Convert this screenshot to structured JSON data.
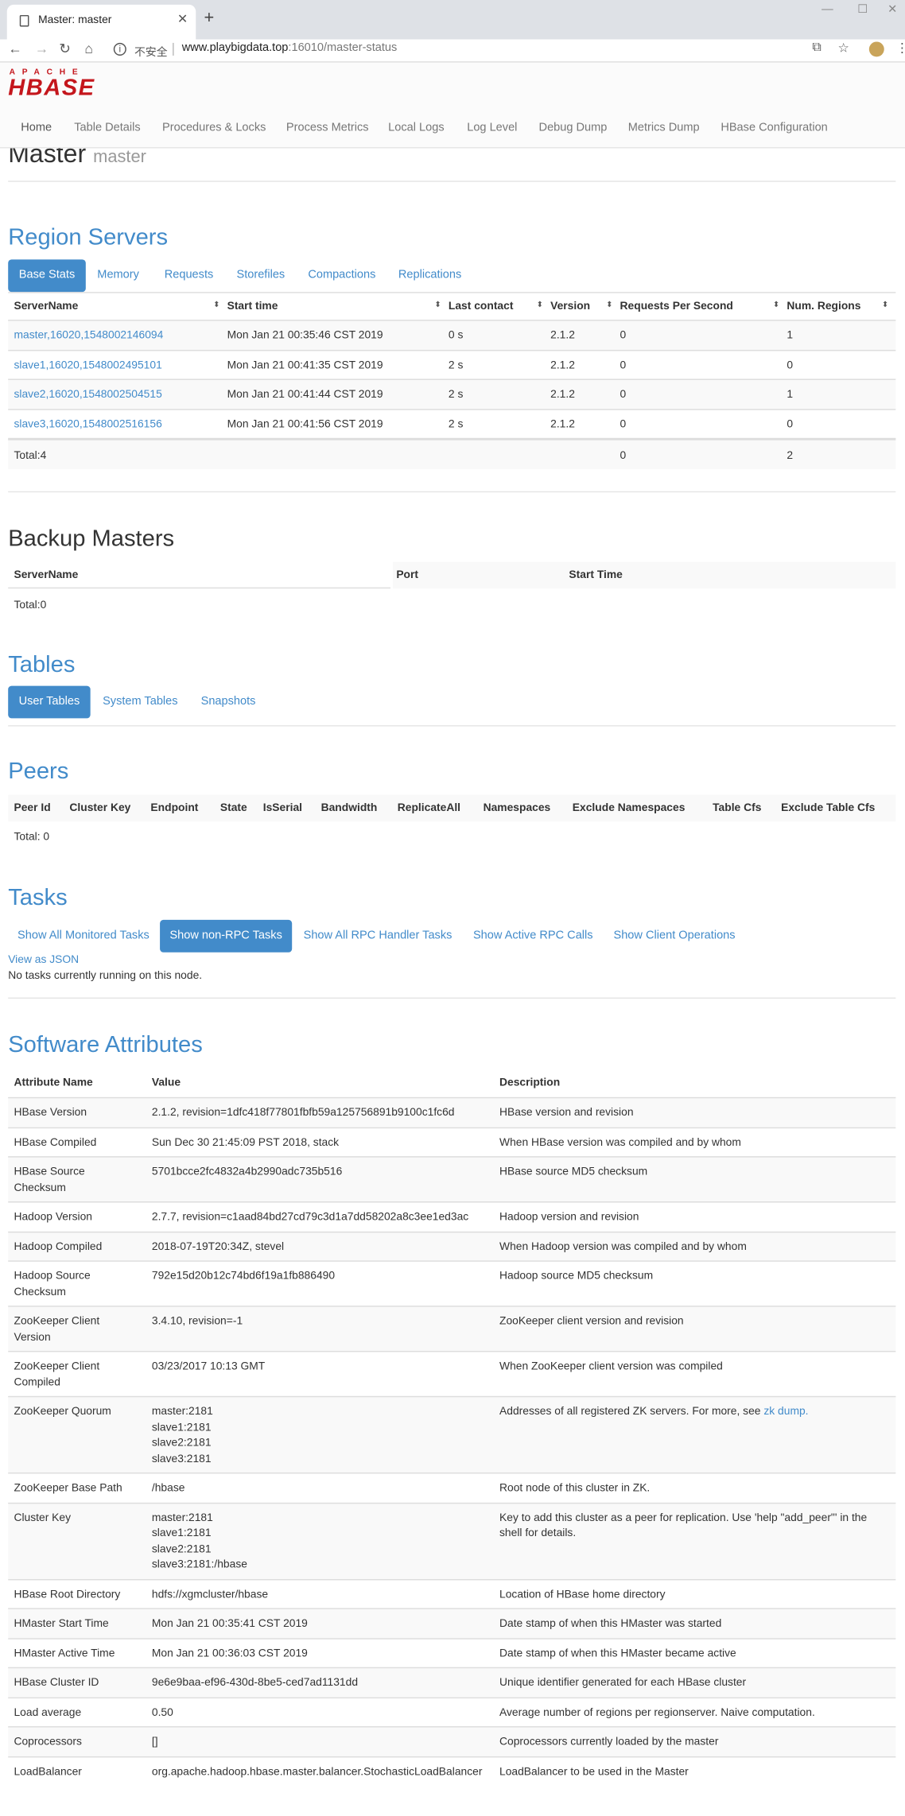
{
  "browser": {
    "tab_title": "Master: master",
    "security_label": "不安全",
    "url_host": "www.playbigdata.top",
    "url_path": ":16010/master-status"
  },
  "logo": {
    "apache": "APACHE",
    "hbase": "HBASE"
  },
  "nav": [
    "Home",
    "Table Details",
    "Procedures & Locks",
    "Process Metrics",
    "Local Logs",
    "Log Level",
    "Debug Dump",
    "Metrics Dump",
    "HBase Configuration"
  ],
  "master": {
    "title": "Master",
    "host": "master"
  },
  "region_servers": {
    "title": "Region Servers",
    "tabs": [
      "Base Stats",
      "Memory",
      "Requests",
      "Storefiles",
      "Compactions",
      "Replications"
    ],
    "columns": [
      "ServerName",
      "Start time",
      "Last contact",
      "Version",
      "Requests Per Second",
      "Num. Regions"
    ],
    "rows": [
      [
        "master,16020,1548002146094",
        "Mon Jan 21 00:35:46 CST 2019",
        "0 s",
        "2.1.2",
        "0",
        "1"
      ],
      [
        "slave1,16020,1548002495101",
        "Mon Jan 21 00:41:35 CST 2019",
        "2 s",
        "2.1.2",
        "0",
        "0"
      ],
      [
        "slave2,16020,1548002504515",
        "Mon Jan 21 00:41:44 CST 2019",
        "2 s",
        "2.1.2",
        "0",
        "1"
      ],
      [
        "slave3,16020,1548002516156",
        "Mon Jan 21 00:41:56 CST 2019",
        "2 s",
        "2.1.2",
        "0",
        "0"
      ]
    ],
    "total": {
      "label": "Total:4",
      "requests": "0",
      "regions": "2"
    }
  },
  "backup": {
    "title": "Backup Masters",
    "columns": [
      "ServerName",
      "Port",
      "Start Time"
    ],
    "total": "Total:0"
  },
  "tables": {
    "title": "Tables",
    "tabs": [
      "User Tables",
      "System Tables",
      "Snapshots"
    ]
  },
  "peers": {
    "title": "Peers",
    "columns": [
      "Peer Id",
      "Cluster Key",
      "Endpoint",
      "State",
      "IsSerial",
      "Bandwidth",
      "ReplicateAll",
      "Namespaces",
      "Exclude Namespaces",
      "Table Cfs",
      "Exclude Table Cfs"
    ],
    "total": "Total: 0"
  },
  "tasks": {
    "title": "Tasks",
    "buttons": [
      "Show All Monitored Tasks",
      "Show non-RPC Tasks",
      "Show All RPC Handler Tasks",
      "Show Active RPC Calls",
      "Show Client Operations"
    ],
    "json_link": "View as JSON",
    "none": "No tasks currently running on this node."
  },
  "software": {
    "title": "Software Attributes",
    "columns": [
      "Attribute Name",
      "Value",
      "Description"
    ],
    "rows": [
      {
        "name": [
          "HBase Version"
        ],
        "value": [
          "2.1.2, revision=1dfc418f77801fbfb59a125756891b9100c1fc6d"
        ],
        "desc": [
          "HBase version and revision"
        ]
      },
      {
        "name": [
          "HBase Compiled"
        ],
        "value": [
          "Sun Dec 30 21:45:09 PST 2018, stack"
        ],
        "desc": [
          "When HBase version was compiled and by whom"
        ]
      },
      {
        "name": [
          "HBase Source",
          "Checksum"
        ],
        "value": [
          "5701bcce2fc4832a4b2990adc735b516"
        ],
        "desc": [
          "HBase source MD5 checksum"
        ]
      },
      {
        "name": [
          "Hadoop Version"
        ],
        "value": [
          "2.7.7, revision=c1aad84bd27cd79c3d1a7dd58202a8c3ee1ed3ac"
        ],
        "desc": [
          "Hadoop version and revision"
        ]
      },
      {
        "name": [
          "Hadoop Compiled"
        ],
        "value": [
          "2018-07-19T20:34Z, stevel"
        ],
        "desc": [
          "When Hadoop version was compiled and by whom"
        ]
      },
      {
        "name": [
          "Hadoop Source",
          "Checksum"
        ],
        "value": [
          "792e15d20b12c74bd6f19a1fb886490"
        ],
        "desc": [
          "Hadoop source MD5 checksum"
        ]
      },
      {
        "name": [
          "ZooKeeper Client",
          "Version"
        ],
        "value": [
          "3.4.10, revision=-1"
        ],
        "desc": [
          "ZooKeeper client version and revision"
        ]
      },
      {
        "name": [
          "ZooKeeper Client",
          "Compiled"
        ],
        "value": [
          "03/23/2017 10:13 GMT"
        ],
        "desc": [
          "When ZooKeeper client version was compiled"
        ]
      },
      {
        "name": [
          "ZooKeeper Quorum"
        ],
        "value": [
          "master:2181",
          "slave1:2181",
          "slave2:2181",
          "slave3:2181"
        ],
        "desc": [
          "Addresses of all registered ZK servers. For more, see "
        ],
        "desc_link": "zk dump."
      },
      {
        "name": [
          "ZooKeeper Base Path"
        ],
        "value": [
          "/hbase"
        ],
        "desc": [
          "Root node of this cluster in ZK."
        ]
      },
      {
        "name": [
          "Cluster Key"
        ],
        "value": [
          "master:2181",
          "slave1:2181",
          "slave2:2181",
          "slave3:2181:/hbase"
        ],
        "desc": [
          "Key to add this cluster as a peer for replication. Use 'help \"add_peer\"' in the",
          "shell for details."
        ]
      },
      {
        "name": [
          "HBase Root Directory"
        ],
        "value": [
          "hdfs://xgmcluster/hbase"
        ],
        "desc": [
          "Location of HBase home directory"
        ]
      },
      {
        "name": [
          "HMaster Start Time"
        ],
        "value": [
          "Mon Jan 21 00:35:41 CST 2019"
        ],
        "desc": [
          "Date stamp of when this HMaster was started"
        ]
      },
      {
        "name": [
          "HMaster Active Time"
        ],
        "value": [
          "Mon Jan 21 00:36:03 CST 2019"
        ],
        "desc": [
          "Date stamp of when this HMaster became active"
        ]
      },
      {
        "name": [
          "HBase Cluster ID"
        ],
        "value": [
          "9e6e9baa-ef96-430d-8be5-ced7ad1131dd"
        ],
        "desc": [
          "Unique identifier generated for each HBase cluster"
        ]
      },
      {
        "name": [
          "Load average"
        ],
        "value": [
          "0.50"
        ],
        "desc": [
          "Average number of regions per regionserver. Naive computation."
        ]
      },
      {
        "name": [
          "Coprocessors"
        ],
        "value": [
          "[]"
        ],
        "desc": [
          "Coprocessors currently loaded by the master"
        ]
      },
      {
        "name": [
          "LoadBalancer"
        ],
        "value": [
          "org.apache.hadoop.hbase.master.balancer.StochasticLoadBalancer"
        ],
        "desc": [
          "LoadBalancer to be used in the Master"
        ]
      }
    ]
  }
}
